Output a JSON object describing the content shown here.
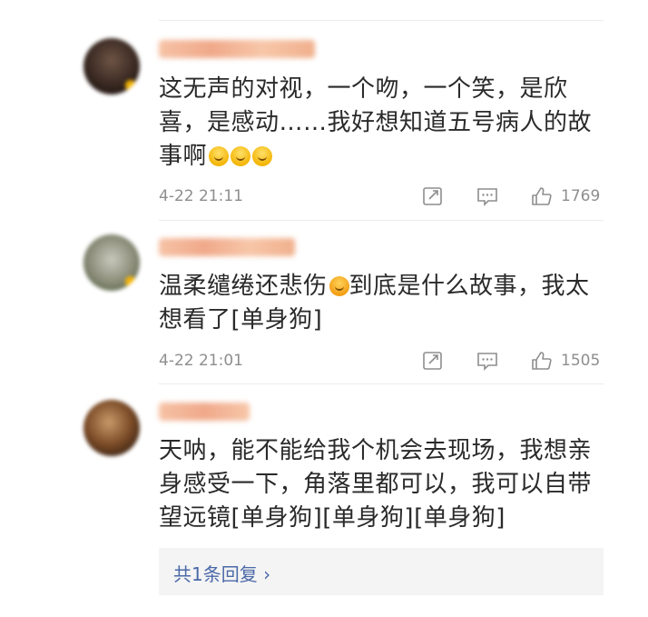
{
  "comments": [
    {
      "avatar_color": "#3a2a24",
      "text": "这无声的对视，一个吻，一个笑，是欣喜，是感动……我好想知道五号病人的故事啊",
      "stickers": [
        "crying-emoji",
        "crying-emoji",
        "crying-emoji"
      ],
      "time": "4-22 21:11",
      "likes": "1769"
    },
    {
      "avatar_color": "#9a9a8a",
      "text_before_sticker": "温柔缱绻还悲伤",
      "text_after_sticker": "到底是什么故事，我太想看了[单身狗]",
      "sticker": "kiss-emoji",
      "time": "4-22 21:01",
      "likes": "1505"
    },
    {
      "avatar_color": "#5a3a20",
      "text": "天呐，能不能给我个机会去现场，我想亲身感受一下，角落里都可以，我可以自带望远镜[单身狗][单身狗][单身狗]",
      "reply_link": "共1条回复 ›"
    }
  ],
  "icons": [
    "share-icon",
    "comment-icon",
    "like-icon"
  ],
  "colors": {
    "link": "#4b69a8",
    "meta": "#8e8e8e",
    "name_blur": "#f1b08a"
  }
}
